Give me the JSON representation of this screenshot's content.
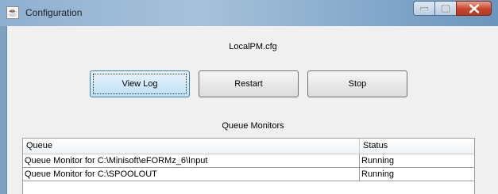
{
  "window": {
    "title": "Configuration",
    "app_icon": "java-icon",
    "controls": [
      "minimize-icon",
      "maximize-icon",
      "close-icon"
    ]
  },
  "config_file": "LocalPM.cfg",
  "buttons": {
    "view_log": "View Log",
    "restart": "Restart",
    "stop": "Stop"
  },
  "section_title": "Queue Monitors",
  "table": {
    "columns": [
      "Queue",
      "Status"
    ],
    "rows": [
      {
        "queue": "Queue Monitor for C:\\Minisoft\\eFORMz_6\\Input",
        "status": "Running"
      },
      {
        "queue": "Queue Monitor for C:\\SPOOLOUT",
        "status": "Running"
      }
    ]
  },
  "colors": {
    "titlebar": "#a7c2db",
    "close_button": "#c8442b",
    "focused_button": "#bfe0f8"
  }
}
